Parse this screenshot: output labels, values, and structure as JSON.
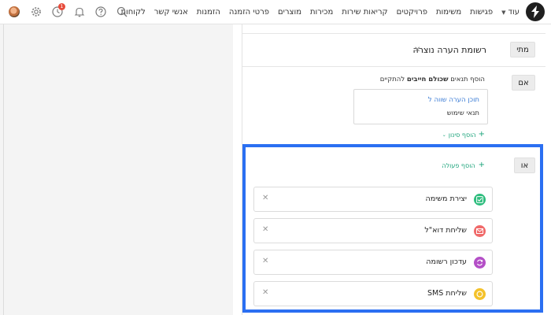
{
  "nav": {
    "items": [
      "לקוחות",
      "אנשי קשר",
      "הזמנות",
      "פרטי הזמנה",
      "מוצרים",
      "מכירות",
      "קריאות שירות",
      "פרויקטים",
      "משימות",
      "פגישות"
    ],
    "more_label": "עוד",
    "notification_count": "1"
  },
  "trigger": {
    "when_tag": "מתי",
    "when_title": "רשומת הערה נוצרה",
    "if_tag": "אם",
    "if_hint_prefix": "הוסף תנאים ",
    "if_hint_bold": "שכולם חייבים",
    "if_hint_suffix": " להתקיים",
    "condition_line1": "תוכן הערה  שווה ל",
    "condition_line2": "תנאי שימוש",
    "add_filter": "הוסף סינון"
  },
  "actions_section": {
    "then_tag": "או",
    "add_action": "הוסף פעולה",
    "items": [
      {
        "label": "יצירת משימה",
        "icon": "task-check-icon",
        "color": "#2ebd7e"
      },
      {
        "label": "שליחת דוא\"ל",
        "icon": "mail-icon",
        "color": "#f06a6a"
      },
      {
        "label": "עדכון רשומה",
        "icon": "refresh-icon",
        "color": "#b44fc7"
      },
      {
        "label": "שליחת SMS",
        "icon": "sms-icon",
        "color": "#f4c22b"
      }
    ]
  },
  "colors": {
    "highlight": "#2b6ff2",
    "link_green": "#1aa37a",
    "link_blue": "#3a7bd5",
    "badge_red": "#e74c3c"
  }
}
